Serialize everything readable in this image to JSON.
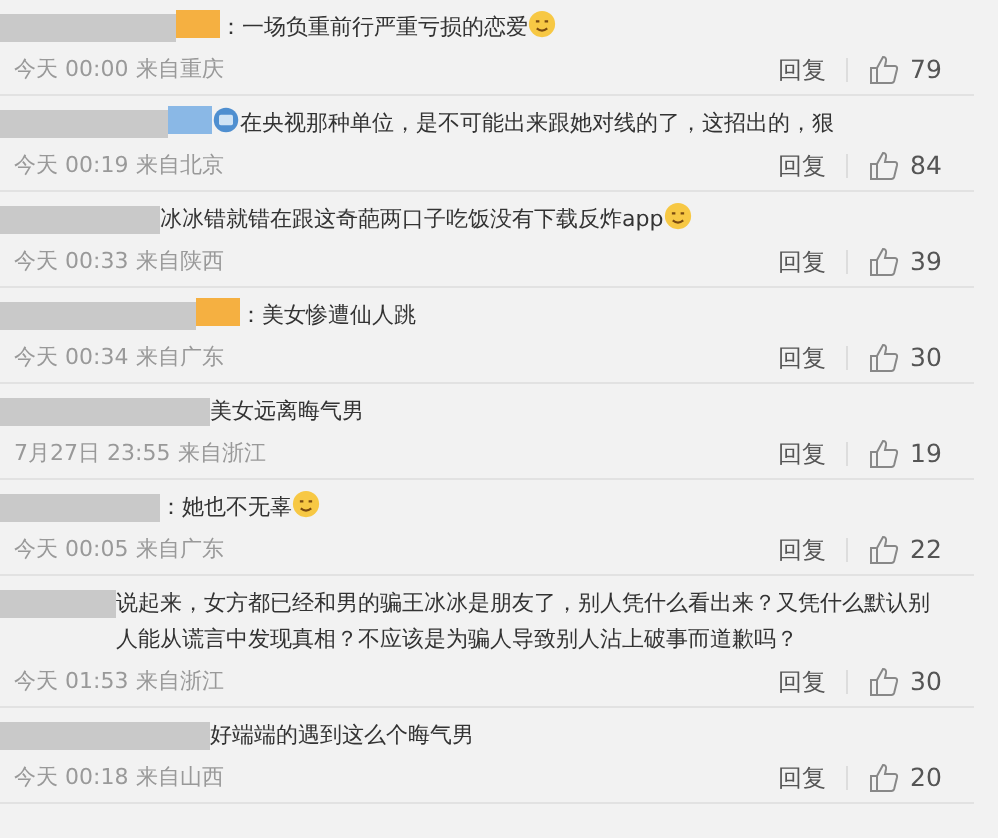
{
  "comments": [
    {
      "badge": {
        "color": "#f5b041"
      },
      "lead_icon": false,
      "text": "：一场负重前行严重亏损的恋爱",
      "emoji": true,
      "time": "今天 00:00",
      "location": "来自重庆",
      "reply": "回复",
      "likes": "79"
    },
    {
      "badge": {
        "color": "#8ab8e6"
      },
      "lead_icon": true,
      "text": "在央视那种单位，是不可能出来跟她对线的了，这招出的，狠",
      "emoji": false,
      "time": "今天 00:19",
      "location": "来自北京",
      "reply": "回复",
      "likes": "84"
    },
    {
      "lead_icon": false,
      "text": "冰冰错就错在跟这奇葩两口子吃饭没有下载反炸app",
      "emoji": true,
      "time": "今天 00:33",
      "location": "来自陕西",
      "reply": "回复",
      "likes": "39"
    },
    {
      "badge": {
        "color": "#f5b041"
      },
      "lead_icon": false,
      "text": "：美女惨遭仙人跳",
      "emoji": false,
      "time": "今天 00:34",
      "location": "来自广东",
      "reply": "回复",
      "likes": "30"
    },
    {
      "lead_icon": false,
      "text": "美女远离晦气男",
      "emoji": false,
      "time": "7月27日 23:55",
      "location": "来自浙江",
      "reply": "回复",
      "likes": "19"
    },
    {
      "lead_icon": false,
      "text": "：她也不无辜",
      "emoji": true,
      "time": "今天 00:05",
      "location": "来自广东",
      "reply": "回复",
      "likes": "22"
    },
    {
      "lead_icon": false,
      "text": "说起来，女方都已经和男的骗王冰冰是朋友了，别人凭什么看出来？又凭什么默认别人能从谎言中发现真相？不应该是为骗人导致别人沾上破事而道歉吗？",
      "emoji": false,
      "time": "今天 01:53",
      "location": "来自浙江",
      "reply": "回复",
      "likes": "30"
    },
    {
      "lead_icon": false,
      "text": "好端端的遇到这么个晦气男",
      "emoji": false,
      "time": "今天 00:18",
      "location": "来自山西",
      "reply": "回复",
      "likes": "20"
    }
  ]
}
